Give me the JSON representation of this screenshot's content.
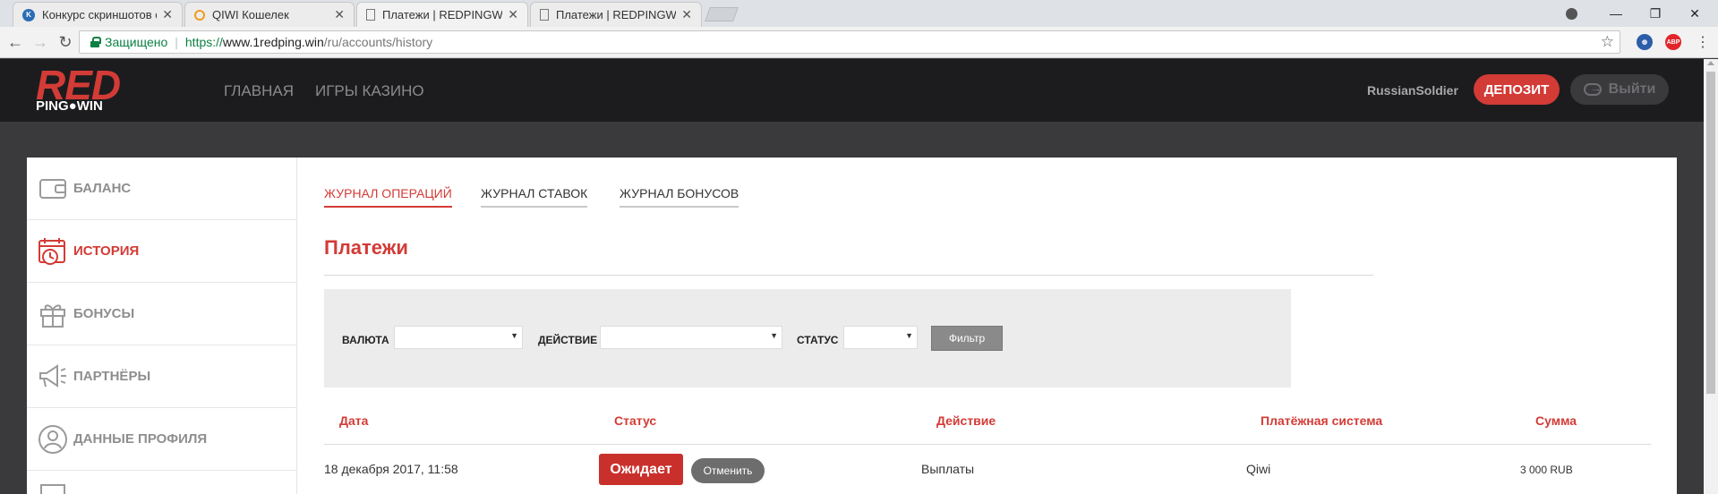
{
  "browser": {
    "tabs": [
      {
        "title": "Конкурс скриншотов от",
        "icon": "ko-favicon-icon"
      },
      {
        "title": "QIWI Кошелек",
        "icon": "qiwi-favicon-icon"
      },
      {
        "title": "Платежи | REDPINGWIN",
        "icon": "page-icon"
      },
      {
        "title": "Платежи | REDPINGWIN",
        "icon": "page-icon"
      }
    ],
    "security_label": "Защищено",
    "url_scheme": "https://",
    "url_host": "www.1redping.win",
    "url_path": "/ru/accounts/history"
  },
  "site": {
    "logo_top": "RED",
    "logo_bottom": "PING●WIN",
    "nav": [
      "ГЛАВНАЯ",
      "ИГРЫ КАЗИНО"
    ],
    "username": "RussianSoldier",
    "deposit_label": "ДЕПОЗИТ",
    "logout_label": "Выйти"
  },
  "sidebar": {
    "items": [
      {
        "label": "БАЛАНС",
        "icon": "wallet-icon",
        "active": false
      },
      {
        "label": "ИСТОРИЯ",
        "icon": "calendar-clock-icon",
        "active": true
      },
      {
        "label": "БОНУСЫ",
        "icon": "gift-icon",
        "active": false
      },
      {
        "label": "ПАРТНЁРЫ",
        "icon": "megaphone-icon",
        "active": false
      },
      {
        "label": "ДАННЫЕ ПРОФИЛЯ",
        "icon": "user-profile-icon",
        "active": false
      }
    ]
  },
  "main": {
    "tabs": [
      {
        "label": "ЖУРНАЛ ОПЕРАЦИЙ",
        "active": true
      },
      {
        "label": "ЖУРНАЛ СТАВОК",
        "active": false
      },
      {
        "label": "ЖУРНАЛ БОНУСОВ",
        "active": false
      }
    ],
    "heading": "Платежи",
    "filter": {
      "currency_label": "ВАЛЮТА",
      "action_label": "ДЕЙСТВИЕ",
      "status_label": "СТАТУС",
      "button_label": "Фильтр"
    },
    "table": {
      "headers": [
        "Дата",
        "Статус",
        "Действие",
        "Платёжная система",
        "Сумма"
      ],
      "rows": [
        {
          "date": "18 декабря 2017, 11:58",
          "status": "Ожидает",
          "cancel_label": "Отменить",
          "action": "Выплаты",
          "system": "Qiwi",
          "amount": "3 000 RUB"
        }
      ]
    }
  },
  "colors": {
    "brand_red": "#d33b36",
    "header_bg": "#1c1c1e",
    "page_bg": "#3a3a3d"
  }
}
